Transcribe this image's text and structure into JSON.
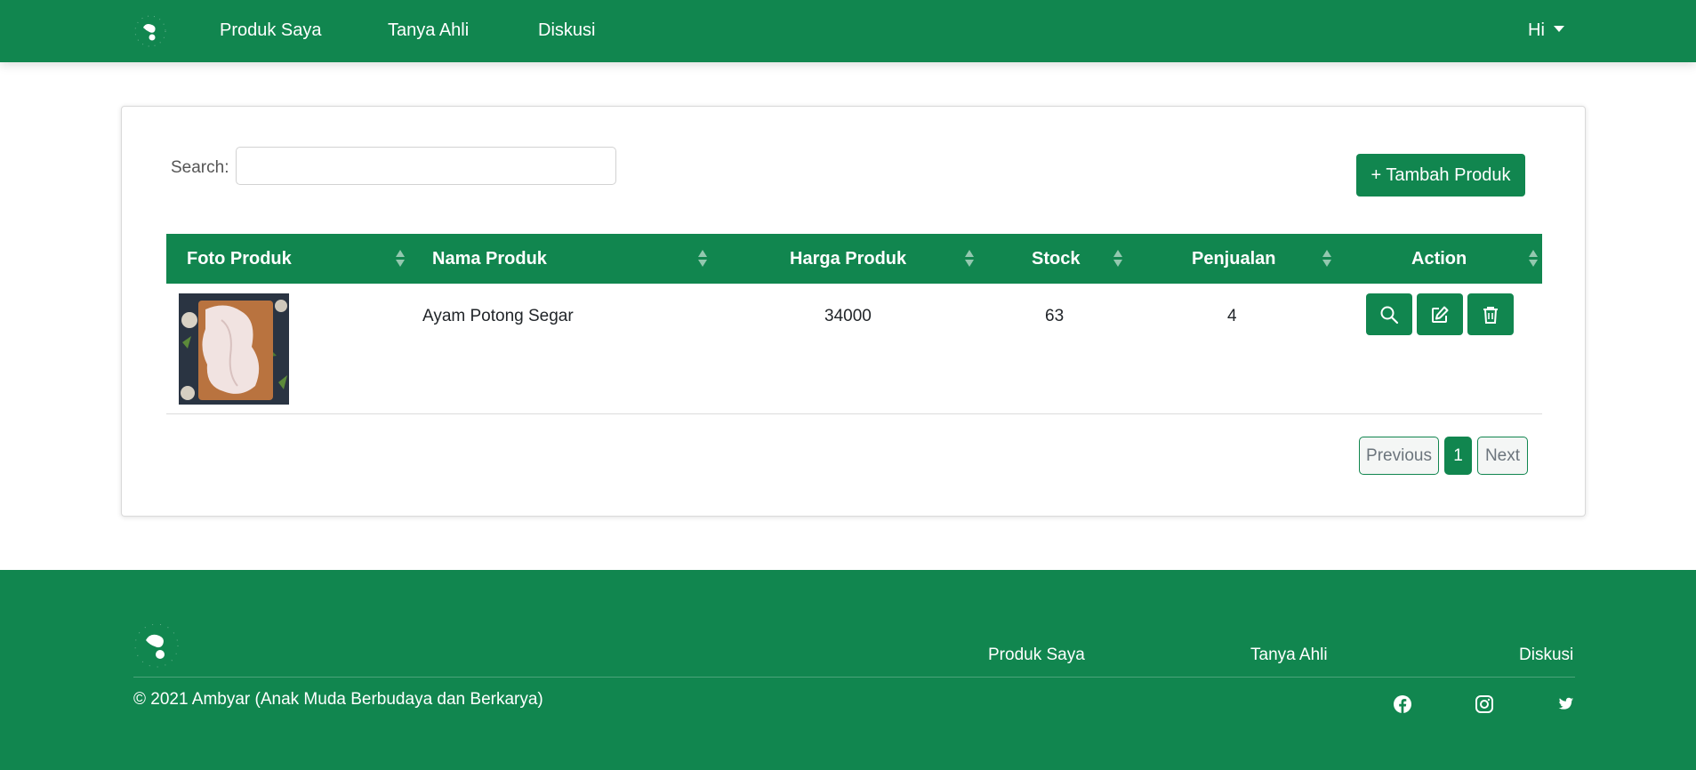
{
  "nav": {
    "links": [
      "Produk Saya",
      "Tanya Ahli",
      "Diskusi"
    ],
    "user": "Hi"
  },
  "toolbar": {
    "search_label": "Search:",
    "search_value": "",
    "add_button": "+ Tambah Produk"
  },
  "table": {
    "headers": [
      "Foto Produk",
      "Nama Produk",
      "Harga Produk",
      "Stock",
      "Penjualan",
      "Action"
    ],
    "rows": [
      {
        "name": "Ayam Potong Segar",
        "price": "34000",
        "stock": "63",
        "sales": "4"
      }
    ]
  },
  "pagination": {
    "previous": "Previous",
    "current": "1",
    "next": "Next"
  },
  "footer": {
    "links": [
      "Produk Saya",
      "Tanya Ahli",
      "Diskusi"
    ],
    "copyright": "© 2021 Ambyar (Anak Muda Berbudaya dan Berkarya)",
    "social": [
      "facebook-icon",
      "instagram-icon",
      "twitter-icon"
    ]
  },
  "colors": {
    "primary": "#11864f"
  }
}
